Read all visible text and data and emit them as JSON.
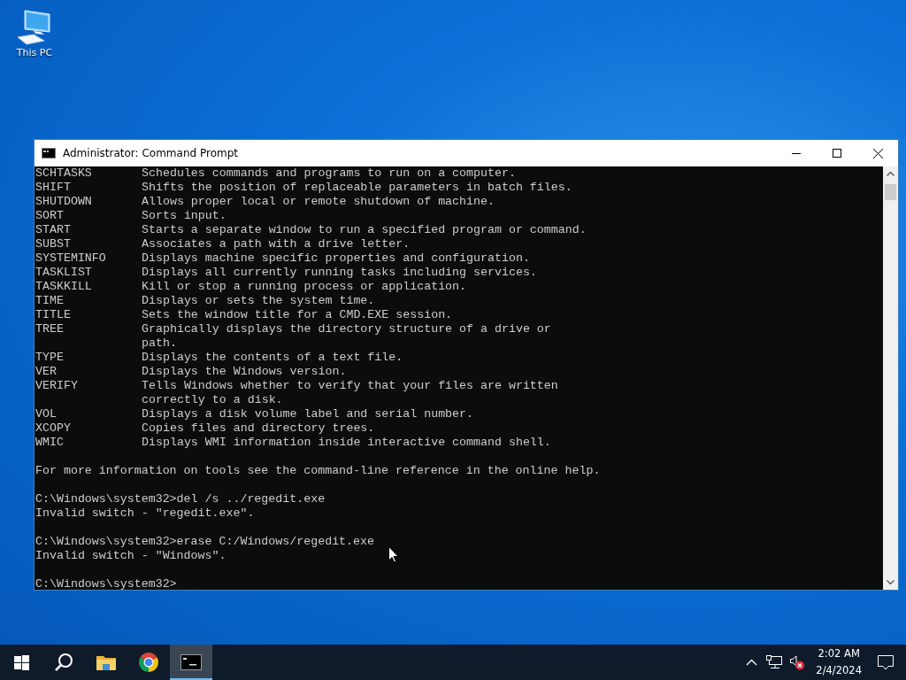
{
  "desktop_icons": [
    {
      "label": "This PC"
    }
  ],
  "window": {
    "title": "Administrator: Command Prompt",
    "console": {
      "help_rows": [
        {
          "command": "SCHTASKS",
          "description": [
            "Schedules commands and programs to run on a computer."
          ]
        },
        {
          "command": "SHIFT",
          "description": [
            "Shifts the position of replaceable parameters in batch files."
          ]
        },
        {
          "command": "SHUTDOWN",
          "description": [
            "Allows proper local or remote shutdown of machine."
          ]
        },
        {
          "command": "SORT",
          "description": [
            "Sorts input."
          ]
        },
        {
          "command": "START",
          "description": [
            "Starts a separate window to run a specified program or command."
          ]
        },
        {
          "command": "SUBST",
          "description": [
            "Associates a path with a drive letter."
          ]
        },
        {
          "command": "SYSTEMINFO",
          "description": [
            "Displays machine specific properties and configuration."
          ]
        },
        {
          "command": "TASKLIST",
          "description": [
            "Displays all currently running tasks including services."
          ]
        },
        {
          "command": "TASKKILL",
          "description": [
            "Kill or stop a running process or application."
          ]
        },
        {
          "command": "TIME",
          "description": [
            "Displays or sets the system time."
          ]
        },
        {
          "command": "TITLE",
          "description": [
            "Sets the window title for a CMD.EXE session."
          ]
        },
        {
          "command": "TREE",
          "description": [
            "Graphically displays the directory structure of a drive or",
            "path."
          ]
        },
        {
          "command": "TYPE",
          "description": [
            "Displays the contents of a text file."
          ]
        },
        {
          "command": "VER",
          "description": [
            "Displays the Windows version."
          ]
        },
        {
          "command": "VERIFY",
          "description": [
            "Tells Windows whether to verify that your files are written",
            "correctly to a disk."
          ]
        },
        {
          "command": "VOL",
          "description": [
            "Displays a disk volume label and serial number."
          ]
        },
        {
          "command": "XCOPY",
          "description": [
            "Copies files and directory trees."
          ]
        },
        {
          "command": "WMIC",
          "description": [
            "Displays WMI information inside interactive command shell."
          ]
        }
      ],
      "sections": [
        {
          "lines": [
            "For more information on tools see the command-line reference in the online help."
          ]
        },
        {
          "lines": [
            "C:\\Windows\\system32>del /s ../regedit.exe",
            "Invalid switch - \"regedit.exe\"."
          ]
        },
        {
          "lines": [
            "C:\\Windows\\system32>erase C:/Windows/regedit.exe",
            "Invalid switch - \"Windows\"."
          ]
        },
        {
          "lines": [
            "C:\\Windows\\system32>"
          ]
        }
      ]
    }
  },
  "taskbar": {
    "apps": [
      {
        "kind": "folder",
        "selected": false
      },
      {
        "kind": "browser",
        "selected": false
      },
      {
        "kind": "terminal",
        "selected": true
      }
    ],
    "time": "2:02 AM",
    "date": "2/4/2024"
  }
}
